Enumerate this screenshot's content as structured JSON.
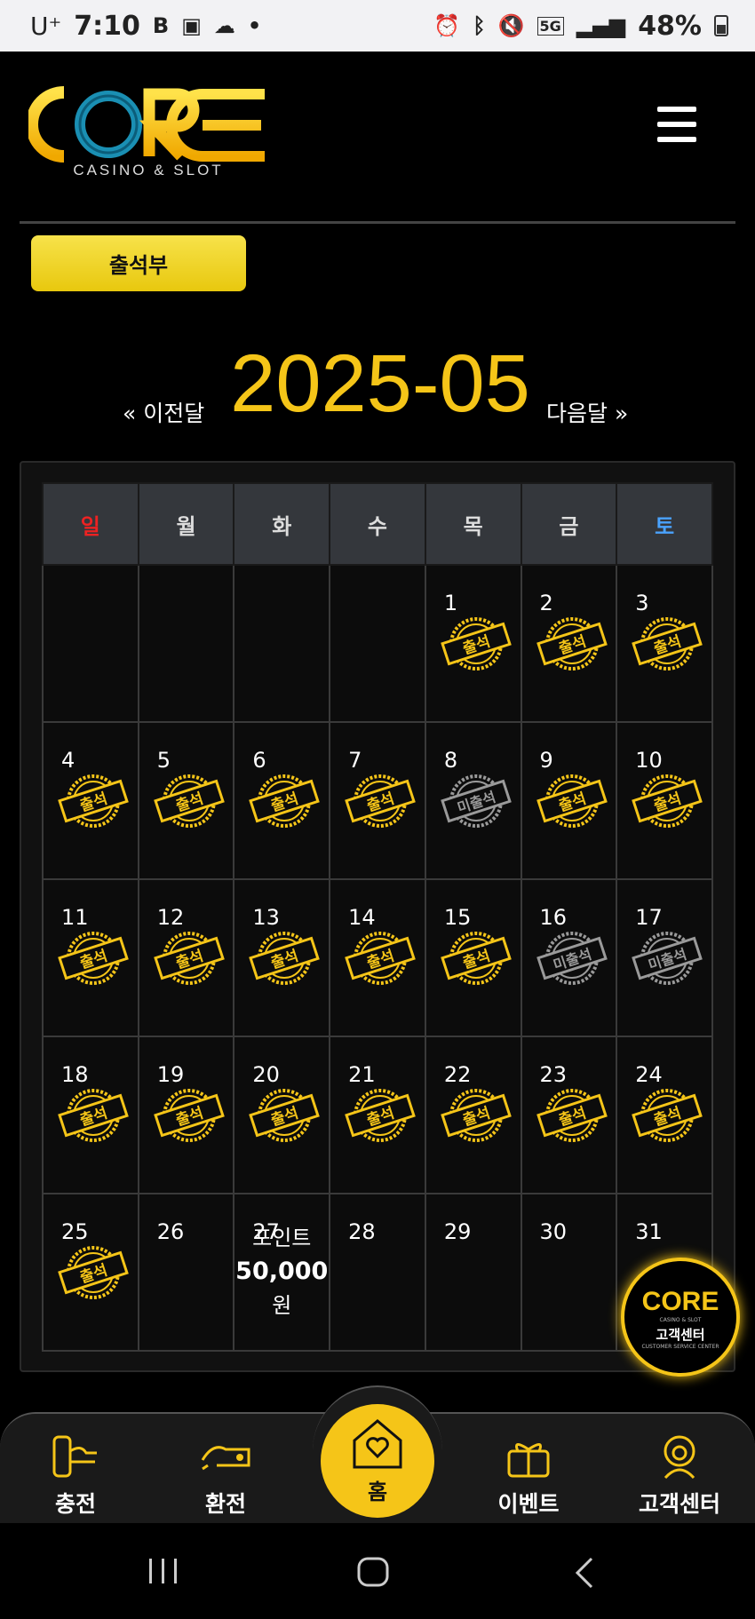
{
  "status_bar": {
    "carrier": "U⁺",
    "time": "7:10",
    "network": "5G",
    "battery": "48%"
  },
  "header": {
    "logo_text": "CORE",
    "logo_sub": "CASINO & SLOT",
    "menu_icon": "hamburger-icon"
  },
  "page_tab": {
    "label": "출석부"
  },
  "month_nav": {
    "prev": "« 이전달",
    "title": "2025-05",
    "next": "다음달 »"
  },
  "calendar": {
    "weekdays": [
      "일",
      "월",
      "화",
      "수",
      "목",
      "금",
      "토"
    ],
    "stamp_attended": "출석",
    "stamp_missed": "미출석",
    "weeks": [
      [
        {
          "d": ""
        },
        {
          "d": ""
        },
        {
          "d": ""
        },
        {
          "d": ""
        },
        {
          "d": "1",
          "s": "att"
        },
        {
          "d": "2",
          "s": "att"
        },
        {
          "d": "3",
          "s": "att"
        }
      ],
      [
        {
          "d": "4",
          "s": "att"
        },
        {
          "d": "5",
          "s": "att"
        },
        {
          "d": "6",
          "s": "att"
        },
        {
          "d": "7",
          "s": "att"
        },
        {
          "d": "8",
          "s": "miss"
        },
        {
          "d": "9",
          "s": "att"
        },
        {
          "d": "10",
          "s": "att"
        }
      ],
      [
        {
          "d": "11",
          "s": "att"
        },
        {
          "d": "12",
          "s": "att"
        },
        {
          "d": "13",
          "s": "att"
        },
        {
          "d": "14",
          "s": "att"
        },
        {
          "d": "15",
          "s": "att"
        },
        {
          "d": "16",
          "s": "miss"
        },
        {
          "d": "17",
          "s": "miss"
        }
      ],
      [
        {
          "d": "18",
          "s": "att"
        },
        {
          "d": "19",
          "s": "att"
        },
        {
          "d": "20",
          "s": "att"
        },
        {
          "d": "21",
          "s": "att"
        },
        {
          "d": "22",
          "s": "att"
        },
        {
          "d": "23",
          "s": "att"
        },
        {
          "d": "24",
          "s": "att"
        }
      ],
      [
        {
          "d": "25",
          "s": "att"
        },
        {
          "d": "26"
        },
        {
          "d": "27",
          "p": true
        },
        {
          "d": "28"
        },
        {
          "d": "29"
        },
        {
          "d": "30"
        },
        {
          "d": "31"
        }
      ]
    ],
    "point_label": "포인트",
    "point_amount": "50,000",
    "point_unit": "원"
  },
  "cs_float": {
    "logo": "CORE",
    "sub": "CASINO & SLOT",
    "label": "고객센터",
    "en": "CUSTOMER SERVICE CENTER"
  },
  "bottom_nav": {
    "charge": "충전",
    "exchange": "환전",
    "home": "홈",
    "event": "이벤트",
    "support": "고객센터"
  },
  "colors": {
    "accent": "#f5c518",
    "sunday": "#e22222",
    "saturday": "#4aa3ff"
  }
}
